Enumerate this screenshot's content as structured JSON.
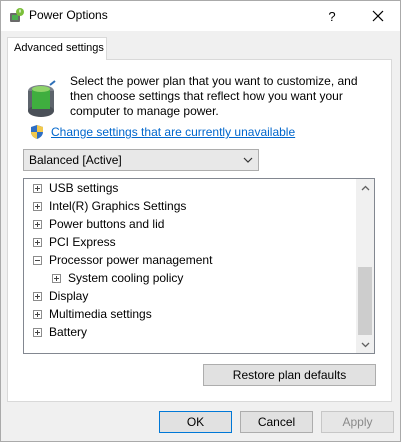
{
  "window": {
    "title": "Power Options",
    "help_glyph": "?",
    "icon": "power-options-icon"
  },
  "tabs": [
    {
      "label": "Advanced settings",
      "selected": true
    }
  ],
  "intro": {
    "text": "Select the power plan that you want to customize, and then choose settings that reflect how you want your computer to manage power.",
    "link": "Change settings that are currently unavailable"
  },
  "plan": {
    "selected": "Balanced [Active]"
  },
  "tree": {
    "items": [
      {
        "label": "USB settings",
        "expander": "plus",
        "level": 0
      },
      {
        "label": "Intel(R) Graphics Settings",
        "expander": "plus",
        "level": 0
      },
      {
        "label": "Power buttons and lid",
        "expander": "plus",
        "level": 0
      },
      {
        "label": "PCI Express",
        "expander": "plus",
        "level": 0
      },
      {
        "label": "Processor power management",
        "expander": "minus",
        "level": 0
      },
      {
        "label": "System cooling policy",
        "expander": "plus",
        "level": 1
      },
      {
        "label": "Display",
        "expander": "plus",
        "level": 0
      },
      {
        "label": "Multimedia settings",
        "expander": "plus",
        "level": 0
      },
      {
        "label": "Battery",
        "expander": "plus",
        "level": 0
      }
    ]
  },
  "buttons": {
    "restore": "Restore plan defaults",
    "ok": "OK",
    "cancel": "Cancel",
    "apply": "Apply"
  },
  "colors": {
    "link": "#0066cc",
    "accent_border": "#0078d7"
  }
}
